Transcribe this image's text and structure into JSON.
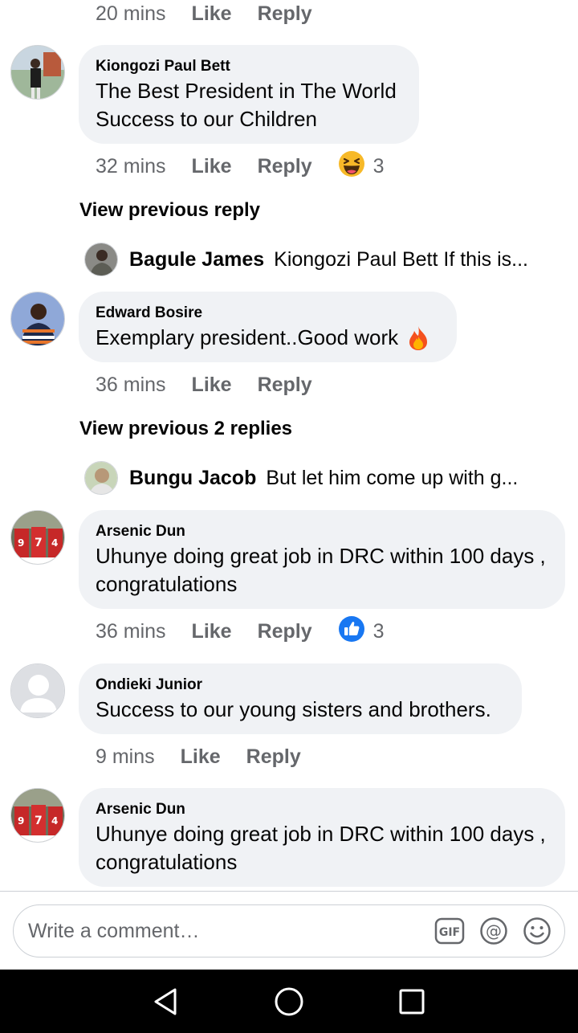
{
  "top_meta": {
    "time": "20 mins",
    "like": "Like",
    "reply": "Reply"
  },
  "comments": [
    {
      "name": "Kiongozi Paul Bett",
      "lines": [
        "The Best President in The World",
        "Success to our Children"
      ],
      "time": "32 mins",
      "like": "Like",
      "reply": "Reply",
      "reaction": "haha-icon",
      "reaction_count": "3"
    },
    {
      "name": "Edward Bosire",
      "lines": [
        "Exemplary president..Good work"
      ],
      "time": "36 mins",
      "like": "Like",
      "reply": "Reply"
    },
    {
      "name": "Arsenic Dun",
      "lines": [
        "Uhunye doing great job in DRC within 100 days ,",
        "congratulations"
      ],
      "time": "36 mins",
      "like": "Like",
      "reply": "Reply",
      "reaction": "like-icon",
      "reaction_count": "3"
    },
    {
      "name": "Ondieki Junior",
      "lines": [
        "Success to our young sisters and brothers."
      ],
      "time": "9 mins",
      "like": "Like",
      "reply": "Reply"
    },
    {
      "name": "Arsenic Dun",
      "lines": [
        "Uhunye doing great job in DRC within 100 days ,",
        "congratulations"
      ]
    }
  ],
  "reply_threads": [
    {
      "view_label": "View previous reply",
      "name": "Bagule James",
      "text": "Kiongozi Paul Bett If this is..."
    },
    {
      "view_label": "View previous 2 replies",
      "name": "Bungu Jacob",
      "text": "But let him come  up with g..."
    }
  ],
  "composer": {
    "placeholder": "Write a comment…",
    "gif_label": "GIF",
    "mention_label": "@"
  },
  "colors": {
    "bubble": "#f0f2f5",
    "meta": "#65676b",
    "like_blue": "#1877f2",
    "haha_yellow": "#f7b928",
    "nav": "#000000"
  }
}
